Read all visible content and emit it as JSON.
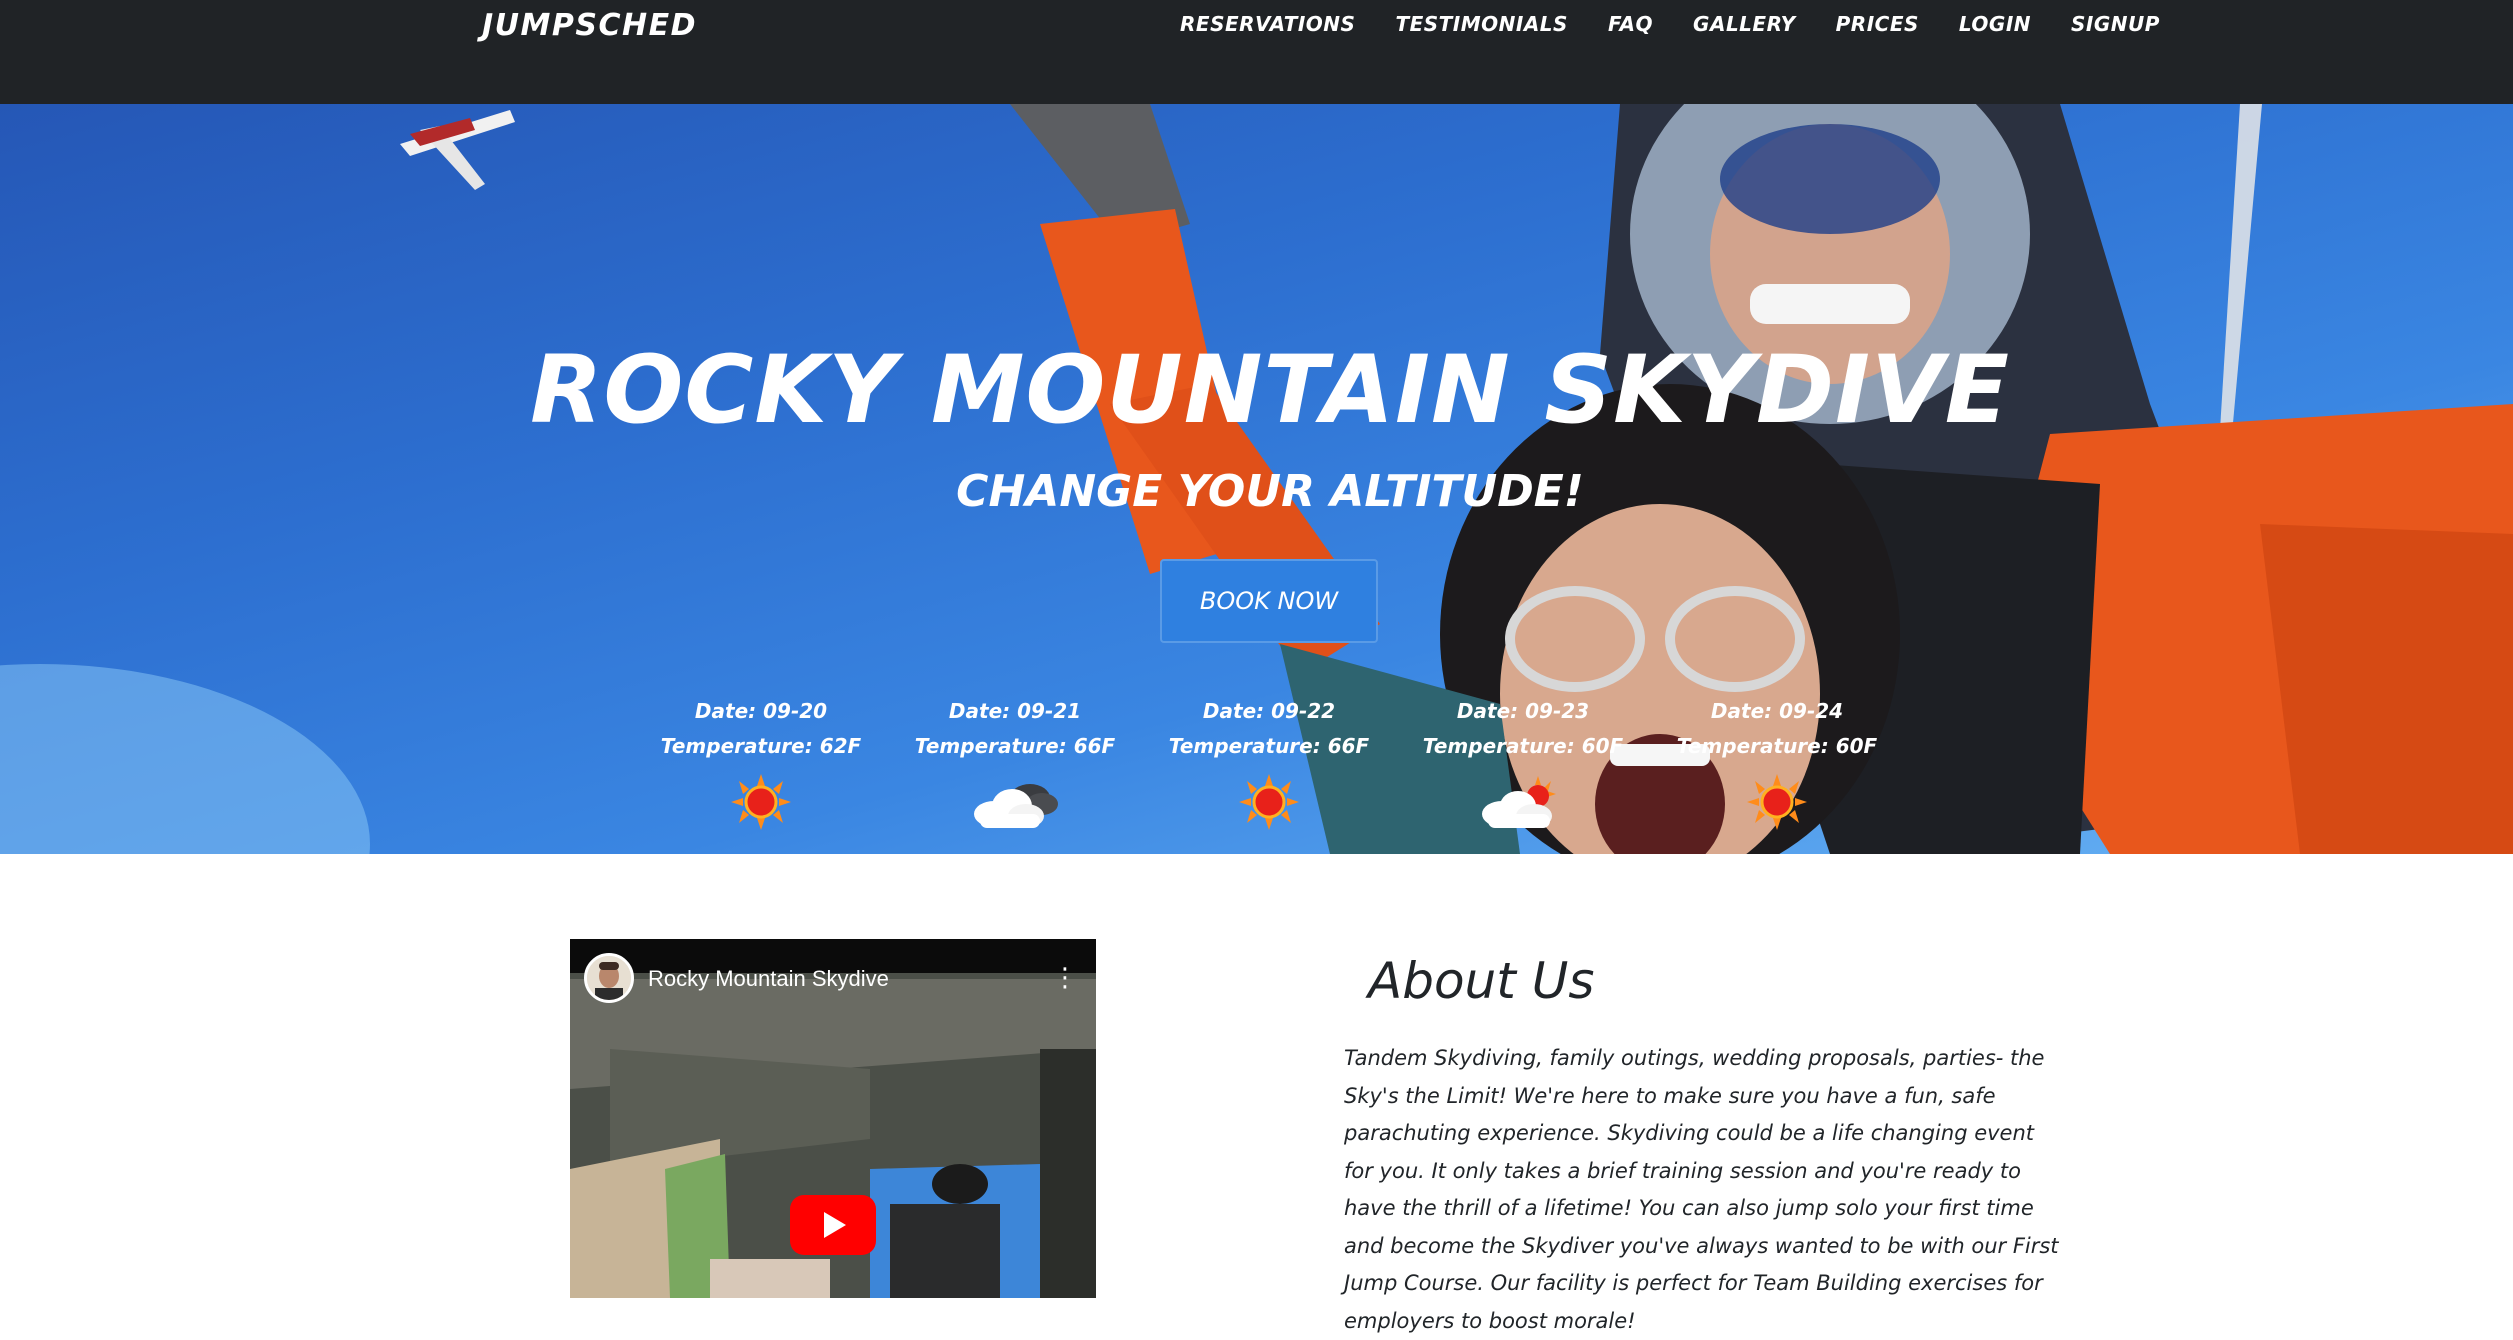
{
  "navbar": {
    "brand": "JUMPSCHED",
    "links": [
      {
        "label": "RESERVATIONS"
      },
      {
        "label": "TESTIMONIALS"
      },
      {
        "label": "FAQ"
      },
      {
        "label": "GALLERY"
      },
      {
        "label": "PRICES"
      },
      {
        "label": "LOGIN"
      },
      {
        "label": "SIGNUP"
      }
    ]
  },
  "hero": {
    "title": "ROCKY MOUNTAIN SKYDIVE",
    "subtitle": "CHANGE YOUR ALTITUDE!",
    "book_button": "BOOK NOW"
  },
  "forecast": [
    {
      "date": "Date: 09-20",
      "temperature": "Temperature: 62F",
      "icon": "sunny-icon"
    },
    {
      "date": "Date: 09-21",
      "temperature": "Temperature: 66F",
      "icon": "cloudy-icon"
    },
    {
      "date": "Date: 09-22",
      "temperature": "Temperature: 66F",
      "icon": "sunny-icon"
    },
    {
      "date": "Date: 09-23",
      "temperature": "Temperature: 60F",
      "icon": "partly-cloudy-icon"
    },
    {
      "date": "Date: 09-24",
      "temperature": "Temperature: 60F",
      "icon": "sunny-icon"
    }
  ],
  "video": {
    "title": "Rocky Mountain Skydive",
    "menu_glyph": "⋮"
  },
  "about": {
    "title": "About Us",
    "text": "Tandem Skydiving, family outings, wedding proposals, parties- the Sky's the Limit! We're here to make sure you have a fun, safe parachuting experience. Skydiving could be a life changing event for you. It only takes a brief training session and you're ready to have the thrill of a lifetime! You can also jump solo your first time and become the Skydiver you've always wanted to be with our First Jump Course. Our facility is perfect for Team Building exercises for employers to boost morale!"
  },
  "colors": {
    "navbar_bg": "#202326",
    "sky_blue": "#2d6fd0",
    "button_blue": "#2f80e0",
    "jacket_orange": "#e8571c",
    "text_dark": "#212529"
  }
}
